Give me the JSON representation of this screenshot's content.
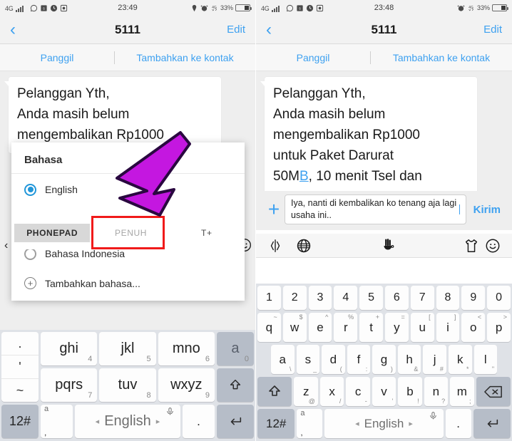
{
  "left": {
    "status": {
      "network": "4G",
      "time": "23:49",
      "battery_percent": "33%",
      "icons": [
        "signal-bars-icon",
        "whatsapp-icon",
        "sms-icon",
        "clock-app-icon",
        "screenshot-icon",
        "location-pin-icon",
        "alarm-icon",
        "mobile-data-4g-icon",
        "battery-icon"
      ]
    },
    "nav": {
      "back": "‹",
      "title": "5111",
      "edit": "Edit"
    },
    "actions": {
      "call": "Panggil",
      "add_contact": "Tambahkan ke kontak"
    },
    "message": {
      "line1": "Pelanggan Yth,",
      "line2": "Anda masih belum",
      "line3": "mengembalikan Rp1000"
    },
    "dialog": {
      "title": "Bahasa",
      "options": [
        {
          "label": "English",
          "selected": true
        },
        {
          "label": "Bahasa Indonesia",
          "selected": false
        }
      ],
      "add_language": "Tambahkan bahasa..."
    },
    "modes": [
      {
        "label": "PHONEPAD",
        "state": "selected"
      },
      {
        "label": "PENUH",
        "state": "highlighted"
      },
      {
        "label": "T+",
        "state": "normal"
      }
    ],
    "keyboard": {
      "type": "phonepad-t9",
      "rows": [
        [
          {
            "label": "ghi",
            "sub": "4"
          },
          {
            "label": "jkl",
            "sub": "5"
          },
          {
            "label": "mno",
            "sub": "6"
          },
          {
            "label": "a",
            "sub": "0",
            "dark": true
          }
        ],
        [
          {
            "label": "pqrs",
            "sub": "7"
          },
          {
            "label": "tuv",
            "sub": "8"
          },
          {
            "label": "wxyz",
            "sub": "9"
          },
          {
            "label": "shift-icon",
            "dark": true
          }
        ]
      ],
      "side_column": [
        ".",
        "'",
        "~"
      ],
      "bottom": {
        "numsym": "12#",
        "comma_top": "a",
        "comma": ",",
        "space_label": "English",
        "mic": "mic-icon",
        "period": ".",
        "enter": "enter-icon"
      }
    }
  },
  "right": {
    "status": {
      "network": "4G",
      "time": "23:48",
      "battery_percent": "33%"
    },
    "nav": {
      "back": "‹",
      "title": "5111",
      "edit": "Edit"
    },
    "actions": {
      "call": "Panggil",
      "add_contact": "Tambahkan ke kontak"
    },
    "message": {
      "line1": "Pelanggan Yth,",
      "line2": "Anda masih belum",
      "line3": "mengembalikan Rp1000",
      "line4": "untuk Paket Darurat",
      "line5_pre": "50M",
      "line5_link": "B",
      "line5_post": ", 10 menit Tsel dan"
    },
    "input": {
      "plus": "+",
      "value": "Iya, nanti di kembalikan ko tenang aja lagi usaha ini..",
      "send": "Kirim"
    },
    "kb_toolbar": [
      "cursor-move-icon",
      "globe-icon",
      "handwriting-icon",
      "theme-shirt-icon",
      "emoji-icon"
    ],
    "keyboard": {
      "type": "qwerty-full",
      "numbers": [
        "1",
        "2",
        "3",
        "4",
        "5",
        "6",
        "7",
        "8",
        "9",
        "0"
      ],
      "row_q": [
        {
          "k": "q",
          "s": "~"
        },
        {
          "k": "w",
          "s": "$"
        },
        {
          "k": "e",
          "s": "^"
        },
        {
          "k": "r",
          "s": "%"
        },
        {
          "k": "t",
          "s": "+"
        },
        {
          "k": "y",
          "s": "="
        },
        {
          "k": "u",
          "s": "["
        },
        {
          "k": "i",
          "s": "]"
        },
        {
          "k": "o",
          "s": "<"
        },
        {
          "k": "p",
          "s": ">"
        }
      ],
      "row_a": [
        {
          "k": "a",
          "s": "\\"
        },
        {
          "k": "s",
          "s": "_"
        },
        {
          "k": "d",
          "s": "("
        },
        {
          "k": "f",
          "s": ":"
        },
        {
          "k": "g",
          "s": ")"
        },
        {
          "k": "h",
          "s": "&"
        },
        {
          "k": "j",
          "s": "#"
        },
        {
          "k": "k",
          "s": "*"
        },
        {
          "k": "l",
          "s": "\""
        }
      ],
      "row_z": [
        {
          "k": "z",
          "s": "@"
        },
        {
          "k": "x",
          "s": "/"
        },
        {
          "k": "c",
          "s": "-"
        },
        {
          "k": "v",
          "s": "'"
        },
        {
          "k": "b",
          "s": "!"
        },
        {
          "k": "n",
          "s": "?"
        },
        {
          "k": "m",
          "s": ";"
        }
      ],
      "shift": "shift-icon",
      "backspace": "backspace-icon",
      "bottom": {
        "numsym": "12#",
        "comma_top": "a",
        "comma": ",",
        "space_label": "English",
        "mic": "mic-icon",
        "period": ".",
        "enter": "enter-icon"
      }
    }
  },
  "annotations": {
    "arrow": {
      "color": "#c417e0",
      "outline": "#2a0840",
      "points_to": "PENUH"
    },
    "highlight_box": {
      "color": "#f01a1a",
      "target": "PENUH"
    }
  }
}
